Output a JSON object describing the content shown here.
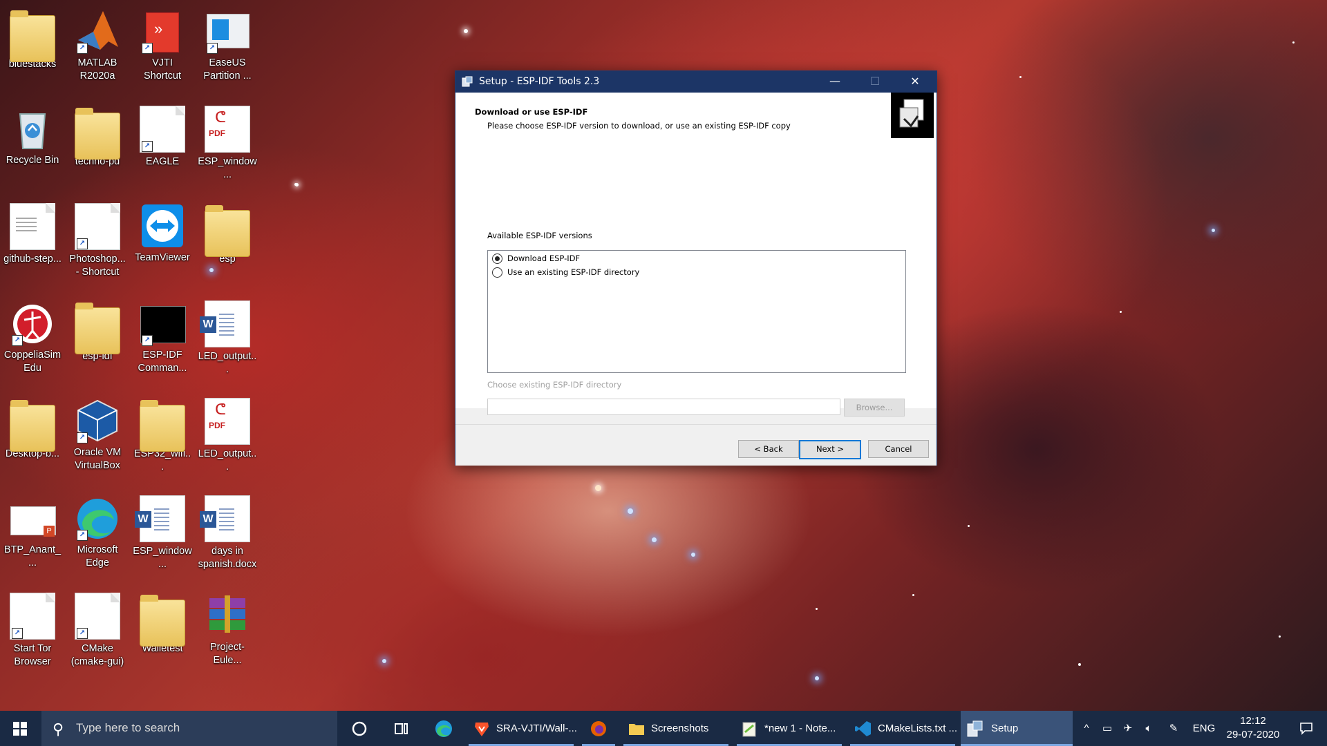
{
  "desktop": {
    "icons": [
      {
        "label": "bluestacks"
      },
      {
        "label": "MATLAB R2020a"
      },
      {
        "label": "VJTI Shortcut"
      },
      {
        "label": "EaseUS Partition ..."
      },
      {
        "label": "Recycle Bin"
      },
      {
        "label": "techno-pd"
      },
      {
        "label": "EAGLE"
      },
      {
        "label": "ESP_window..."
      },
      {
        "label": "github-step..."
      },
      {
        "label": "Photoshop... - Shortcut"
      },
      {
        "label": "TeamViewer"
      },
      {
        "label": "esp"
      },
      {
        "label": "CoppeliaSim Edu"
      },
      {
        "label": "esp-idf"
      },
      {
        "label": "ESP-IDF Comman..."
      },
      {
        "label": "LED_output..."
      },
      {
        "label": "Desktop-b..."
      },
      {
        "label": "Oracle VM VirtualBox"
      },
      {
        "label": "ESP32_wifi..."
      },
      {
        "label": "LED_output..."
      },
      {
        "label": "BTP_Anant_..."
      },
      {
        "label": "Microsoft Edge"
      },
      {
        "label": "ESP_window..."
      },
      {
        "label": "days in spanish.docx"
      },
      {
        "label": "Start Tor Browser"
      },
      {
        "label": "CMake (cmake-gui)"
      },
      {
        "label": "Walletest"
      },
      {
        "label": "Project-Eule..."
      }
    ]
  },
  "dialog": {
    "title": "Setup - ESP-IDF Tools 2.3",
    "window_controls": {
      "minimize": "—",
      "maximize": "☐",
      "close": "✕"
    },
    "heading": "Download or use ESP-IDF",
    "subheading": "Please choose ESP-IDF version to download, or use an existing ESP-IDF copy",
    "versions_label": "Available ESP-IDF versions",
    "options": [
      {
        "label": "Download ESP-IDF",
        "selected": true
      },
      {
        "label": "Use an existing ESP-IDF directory",
        "selected": false
      }
    ],
    "directory_label": "Choose existing ESP-IDF directory",
    "directory_value": "",
    "browse_label": "Browse...",
    "back_label": "< Back",
    "next_label": "Next >",
    "cancel_label": "Cancel"
  },
  "taskbar": {
    "search_placeholder": "Type here to search",
    "items": [
      {
        "label": "SRA-VJTI/Wall-..."
      },
      {
        "label": "Screenshots"
      },
      {
        "label": "*new 1 - Note..."
      },
      {
        "label": "CMakeLists.txt ..."
      },
      {
        "label": "Setup"
      }
    ],
    "language": "ENG",
    "time": "12:12",
    "date": "29-07-2020"
  },
  "colors": {
    "titlebar": "#1c3566",
    "taskbar": "#1a2a44",
    "accent": "#0078d7"
  }
}
